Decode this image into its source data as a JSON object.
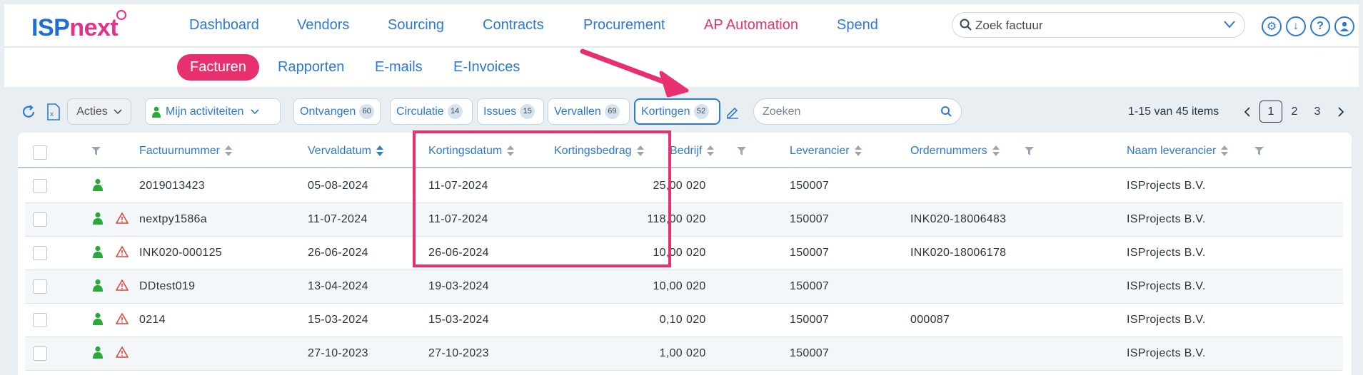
{
  "logo": {
    "part1": "ISP",
    "part2": "next"
  },
  "nav": {
    "items": [
      {
        "label": "Dashboard"
      },
      {
        "label": "Vendors"
      },
      {
        "label": "Sourcing"
      },
      {
        "label": "Contracts"
      },
      {
        "label": "Procurement"
      },
      {
        "label": "AP Automation",
        "active": true
      },
      {
        "label": "Spend"
      }
    ],
    "search_placeholder": "Zoek factuur"
  },
  "topicons": [
    "gear-icon",
    "download-icon",
    "help-icon",
    "user-icon"
  ],
  "subnav": {
    "items": [
      {
        "label": "Facturen",
        "active": true
      },
      {
        "label": "Rapporten"
      },
      {
        "label": "E-mails"
      },
      {
        "label": "E-Invoices"
      }
    ]
  },
  "toolbar": {
    "acties": "Acties",
    "mijn": "Mijn activiteiten",
    "filters": [
      {
        "label": "Ontvangen",
        "count": "60"
      },
      {
        "label": "Circulatie",
        "count": "14"
      },
      {
        "label": "Issues",
        "count": "15"
      },
      {
        "label": "Vervallen",
        "count": "69"
      },
      {
        "label": "Kortingen",
        "count": "52",
        "active": true
      }
    ],
    "search_placeholder": "Zoeken",
    "items_text": "1-15 van 45 items",
    "pages": [
      "1",
      "2",
      "3"
    ],
    "current_page": "1"
  },
  "table": {
    "headers": {
      "factuurnummer": "Factuurnummer",
      "vervaldatum": "Vervaldatum",
      "kortingsdatum": "Kortingsdatum",
      "kortingsbedrag": "Kortingsbedrag",
      "bedrijf": "Bedrijf",
      "leverancier": "Leverancier",
      "ordernummers": "Ordernummers",
      "naam": "Naam leverancier"
    },
    "rows": [
      {
        "factuurnummer": "2019013423",
        "vervaldatum": "05-08-2024",
        "kortingsdatum": "11-07-2024",
        "kortingsbedrag": "25,00",
        "bedrijf": "020",
        "leverancier": "150007",
        "ordernummers": "",
        "naam": "ISProjects B.V.",
        "warning": false
      },
      {
        "factuurnummer": "nextpy1586a",
        "vervaldatum": "11-07-2024",
        "kortingsdatum": "11-07-2024",
        "kortingsbedrag": "118,00",
        "bedrijf": "020",
        "leverancier": "150007",
        "ordernummers": "INK020-18006483",
        "naam": "ISProjects B.V.",
        "warning": true
      },
      {
        "factuurnummer": "INK020-000125",
        "vervaldatum": "26-06-2024",
        "kortingsdatum": "26-06-2024",
        "kortingsbedrag": "10,00",
        "bedrijf": "020",
        "leverancier": "150007",
        "ordernummers": "INK020-18006178",
        "naam": "ISProjects B.V.",
        "warning": true
      },
      {
        "factuurnummer": "DDtest019",
        "vervaldatum": "13-04-2024",
        "kortingsdatum": "19-03-2024",
        "kortingsbedrag": "10,00",
        "bedrijf": "020",
        "leverancier": "150007",
        "ordernummers": "",
        "naam": "ISProjects B.V.",
        "warning": true
      },
      {
        "factuurnummer": "0214",
        "vervaldatum": "15-03-2024",
        "kortingsdatum": "15-03-2024",
        "kortingsbedrag": "0,10",
        "bedrijf": "020",
        "leverancier": "150007",
        "ordernummers": "000087",
        "naam": "ISProjects B.V.",
        "warning": true
      },
      {
        "factuurnummer": "",
        "vervaldatum": "27-10-2023",
        "kortingsdatum": "27-10-2023",
        "kortingsbedrag": "1,00",
        "bedrijf": "020",
        "leverancier": "150007",
        "ordernummers": "",
        "naam": "ISProjects B.V.",
        "warning": true
      }
    ]
  },
  "colors": {
    "brand_blue": "#2b7ad6",
    "brand_pink": "#e8306f",
    "status_green": "#2aa83a",
    "warning_red": "#e0453a"
  }
}
